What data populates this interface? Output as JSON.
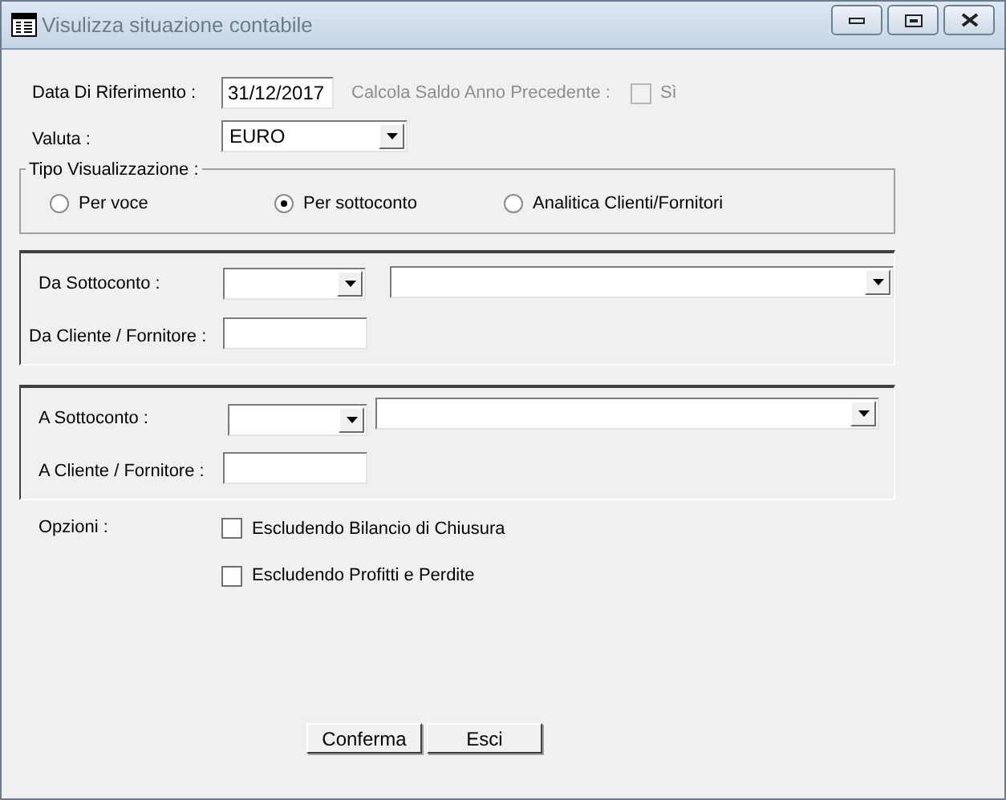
{
  "window": {
    "title": "Visulizza situazione contabile"
  },
  "date": {
    "label": "Data Di Riferimento :",
    "value": "31/12/2017"
  },
  "prev_year": {
    "label": "Calcola Saldo Anno Precedente :",
    "option": "Sì",
    "checked": false,
    "disabled": true
  },
  "currency": {
    "label": "Valuta :",
    "value": "EURO"
  },
  "view_type": {
    "legend": "Tipo  Visualizzazione :",
    "options": [
      {
        "label": "Per voce",
        "selected": false
      },
      {
        "label": "Per sottoconto",
        "selected": true
      },
      {
        "label": "Analitica Clienti/Fornitori",
        "selected": false
      }
    ]
  },
  "from": {
    "account_label": "Da Sottoconto :",
    "customer_label": "Da Cliente / Fornitore :"
  },
  "to": {
    "account_label": "A Sottoconto :",
    "customer_label": "A Cliente / Fornitore :"
  },
  "options": {
    "label": "Opzioni :",
    "items": [
      {
        "label": "Escludendo Bilancio di Chiusura",
        "checked": false
      },
      {
        "label": "Escludendo Profitti e Perdite",
        "checked": false
      }
    ]
  },
  "buttons": [
    "Conferma",
    "Esci"
  ]
}
